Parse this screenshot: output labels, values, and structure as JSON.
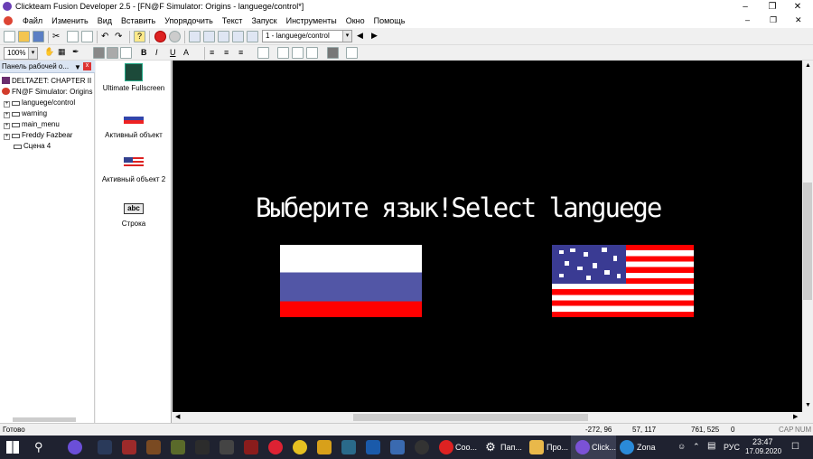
{
  "window": {
    "title": "Clickteam Fusion Developer 2.5 - [FN@F Simulator: Origins - languege/control*]"
  },
  "menu": [
    "Файл",
    "Изменить",
    "Вид",
    "Вставить",
    "Упорядочить",
    "Текст",
    "Запуск",
    "Инструменты",
    "Окно",
    "Помощь"
  ],
  "toolbar": {
    "frame_select": "1 - languege/control",
    "zoom": "100%"
  },
  "workspace": {
    "header": "Панель рабочей о...",
    "items": [
      {
        "label": "DELTAZET: CHAPTER II",
        "type": "app"
      },
      {
        "label": "FN@F Simulator: Origins",
        "type": "app"
      },
      {
        "label": "languege/control",
        "type": "frame"
      },
      {
        "label": "warning",
        "type": "frame"
      },
      {
        "label": "main_menu",
        "type": "frame"
      },
      {
        "label": "Freddy Fazbear",
        "type": "frame"
      },
      {
        "label": "Сцена 4",
        "type": "frame"
      }
    ]
  },
  "objects": [
    {
      "label": "Ultimate Fullscreen",
      "icon": "fullscreen-icon"
    },
    {
      "label": "Активный объект",
      "icon": "russian-flag-icon"
    },
    {
      "label": "Активный объект 2",
      "icon": "us-flag-icon"
    },
    {
      "label": "Строка",
      "icon": "abc-string-icon"
    }
  ],
  "canvas": {
    "title_text": "Выберите язык!Select languege",
    "background": "#000000"
  },
  "status": {
    "left": "Готово",
    "coords1": "-272, 96",
    "coords2": "57, 117",
    "coords3": "761, 525",
    "count": "0",
    "caps": "CAP",
    "num": "NUM"
  },
  "taskbar": {
    "apps": [
      "Coo...",
      "Пап...",
      "Про...",
      "Click...",
      "Zona"
    ],
    "lang": "РУС",
    "time": "23:47",
    "date": "17.09.2020"
  }
}
